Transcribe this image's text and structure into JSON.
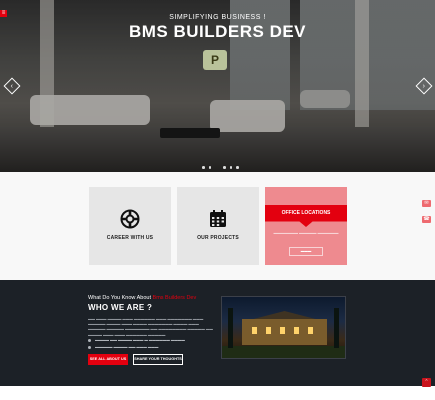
{
  "hero": {
    "tagline": "SIMPLIFYING BUSINESS !",
    "title": "BMS BUILDERS DEV",
    "menu_icon": "menu-icon",
    "prev_icon": "chevron-left-icon",
    "next_icon": "chevron-right-icon",
    "slide_count": 6
  },
  "services": {
    "cards": [
      {
        "label": "CAREER WITH US",
        "icon": "lifebuoy-icon"
      },
      {
        "label": "OUR PROJECTS",
        "icon": "calendar-icon"
      },
      {
        "label": "OFFICE LOCATIONS",
        "icon": "map-pin-icon",
        "highlighted": true
      }
    ],
    "side_icons": [
      "mail-icon",
      "phone-icon"
    ]
  },
  "about": {
    "kicker": "What Do You Know About",
    "kicker_brand": "Bms Builders Dev",
    "heading": "WHO WE ARE ?",
    "bullets": [
      "",
      ""
    ],
    "primary_button": "SEE ALL ABOUT US",
    "secondary_button": "SHARE YOUR THOUGHTS"
  },
  "colors": {
    "accent": "#e3000f",
    "dark": "#1c2127",
    "card": "#e6e6e6"
  }
}
